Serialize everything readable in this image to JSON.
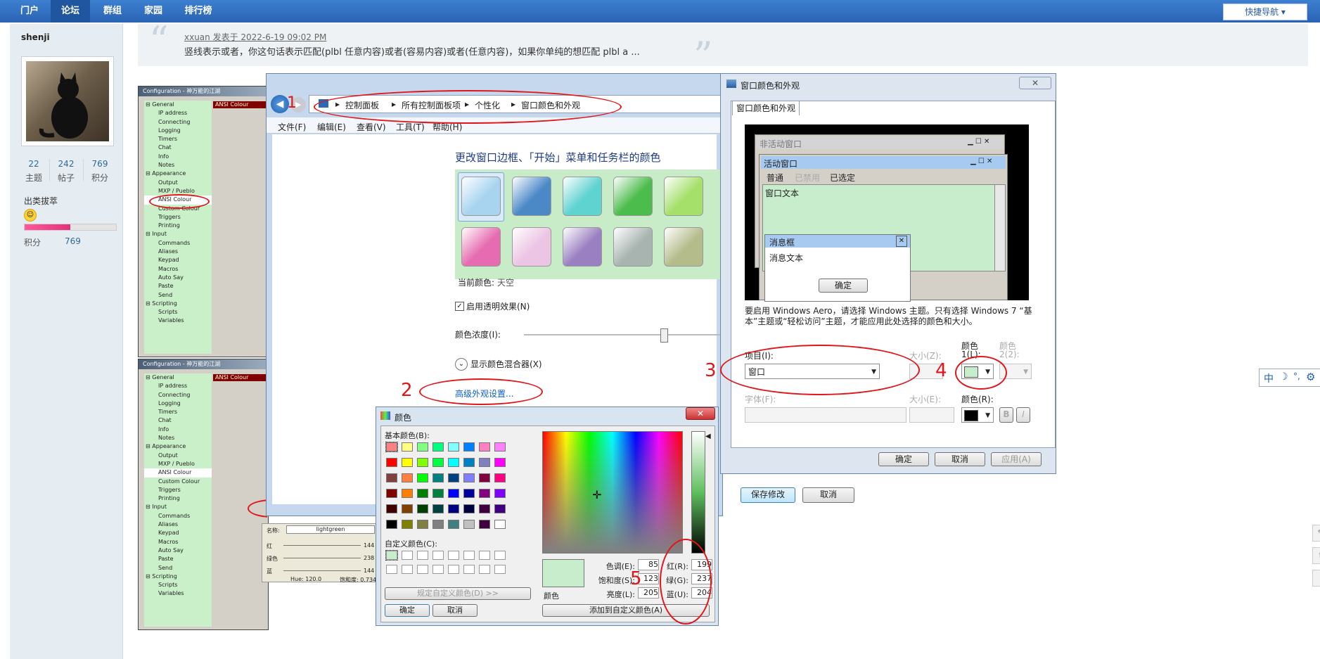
{
  "nav": {
    "items": [
      "门户",
      "论坛",
      "群组",
      "家园",
      "排行榜"
    ],
    "quick_nav": "快捷导航 ▾"
  },
  "profile": {
    "username": "shenji",
    "stats": [
      {
        "value": "22",
        "label": "主题"
      },
      {
        "value": "242",
        "label": "帖子"
      },
      {
        "value": "769",
        "label": "积分"
      }
    ],
    "rank": "出类拔萃",
    "points_label": "积分",
    "points_value": "769",
    "progress_fraction": 0.5
  },
  "quote": {
    "meta": "xxuan 发表于 2022-6-19 09:02 PM",
    "text": "竖线表示或者，你这句话表示匹配(plbl 任意内容)或者(容易内容)或者(任意内容)，如果你单纯的想匹配 plbl a ..."
  },
  "config_panel": {
    "title": "Configuration - 神万能的江湖",
    "ansi_label": "ANSI Colour",
    "tree": [
      "General",
      "IP address",
      "Connecting",
      "Logging",
      "Timers",
      "Chat",
      "Info",
      "Notes",
      "Appearance",
      "Output",
      "MXP / Pueblo",
      "ANSI Colour",
      "Custom Colour",
      "Triggers",
      "Printing",
      "Input",
      "Commands",
      "Aliases",
      "Keypad",
      "Macros",
      "Auto Say",
      "Paste",
      "Send",
      "Scripting",
      "Scripts",
      "Variables"
    ]
  },
  "config_lower": {
    "name_label": "名称:",
    "name_value": "lightgreen",
    "sliders": [
      {
        "label": "红",
        "value": "144"
      },
      {
        "label": "绿色",
        "value": "238"
      },
      {
        "label": "蓝",
        "value": "144"
      }
    ],
    "footer_left": "Hue: 120.0",
    "footer_right": "饱和度: 0.734"
  },
  "control_panel": {
    "breadcrumbs": [
      "控制面板",
      "所有控制面板项",
      "个性化",
      "窗口颜色和外观"
    ],
    "menu": [
      "文件(F)",
      "编辑(E)",
      "查看(V)",
      "工具(T)",
      "帮助(H)"
    ],
    "heading": "更改窗口边框、「开始」菜单和任务栏的颜色",
    "swatches_row1": [
      "#a8d4f0",
      "#4a88c6",
      "#5fd3d0",
      "#4cbc4c",
      "#a4e06a"
    ],
    "swatches_row2": [
      "#e66bb0",
      "#ecc4e4",
      "#9a80c0",
      "#a8b4b0",
      "#b4bc8c"
    ],
    "current_color_label": "当前颜色:",
    "current_color_value": "天空",
    "transparency_label": "启用透明效果(N)",
    "intensity_label": "颜色浓度(I):",
    "intensity_fraction": 0.72,
    "mixer_label": "显示颜色混合器(X)",
    "advanced_link": "高级外观设置...",
    "save_button": "保存修改",
    "cancel_button": "取消"
  },
  "window_color": {
    "title": "窗口颜色和外观",
    "tab": "窗口颜色和外观",
    "inactive_window": "非活动窗口",
    "active_window": "活动窗口",
    "menu_items": [
      "普通",
      "已禁用",
      "已选定"
    ],
    "window_text": "窗口文本",
    "msgbox_title": "消息框",
    "msgbox_text": "消息文本",
    "msgbox_ok": "确定",
    "description": "要启用 Windows Aero，请选择 Windows 主题。只有选择 Windows 7 “基本”主题或“轻松访问”主题，才能应用此处选择的颜色和大小。",
    "item_label": "项目(I):",
    "item_value": "窗口",
    "size_label": "大小(Z):",
    "color1_label_top": "颜色",
    "color1_label_bottom": "1(L):",
    "color2_label_top": "颜色",
    "color2_label_bottom": "2(2):",
    "font_label": "字体(F):",
    "font_size_label": "大小(E):",
    "font_color_label": "颜色(R):",
    "bold_label": "B",
    "italic_label": "I",
    "ok_button": "确定",
    "cancel_button": "取消",
    "apply_button": "应用(A)",
    "color1_value": "#c7edcc",
    "font_color_value": "#000000"
  },
  "color_picker": {
    "title": "颜色",
    "basic_colors_label": "基本颜色(B):",
    "basic_colors": [
      "#ff8080",
      "#ffff80",
      "#80ff80",
      "#00ff80",
      "#80ffff",
      "#0080ff",
      "#ff80c0",
      "#ff80ff",
      "#ff0000",
      "#ffff00",
      "#80ff00",
      "#00ff40",
      "#00ffff",
      "#0080c0",
      "#8080c0",
      "#ff00ff",
      "#804040",
      "#ff8040",
      "#00ff00",
      "#008080",
      "#004080",
      "#8080ff",
      "#800040",
      "#ff0080",
      "#800000",
      "#ff8000",
      "#008000",
      "#008040",
      "#0000ff",
      "#0000a0",
      "#800080",
      "#8000ff",
      "#400000",
      "#804000",
      "#004000",
      "#004040",
      "#000080",
      "#000040",
      "#400040",
      "#400080",
      "#000000",
      "#808000",
      "#808040",
      "#808080",
      "#408080",
      "#c0c0c0",
      "#400040",
      "#ffffff"
    ],
    "custom_colors_label": "自定义颜色(C):",
    "define_custom_button": "规定自定义颜色(D) >>",
    "ok_button": "确定",
    "cancel_button": "取消",
    "color_solid_label": "颜色",
    "hue_label": "色调(E):",
    "hue_value": "85",
    "sat_label": "饱和度(S):",
    "sat_value": "123",
    "lum_label": "亮度(L):",
    "lum_value": "205",
    "red_label": "红(R):",
    "red_value": "199",
    "green_label": "绿(G):",
    "green_value": "237",
    "blue_label": "蓝(U):",
    "blue_value": "204",
    "add_custom_button": "添加到自定义颜色(A)",
    "selected_color": "#c7edcc"
  },
  "annotations": [
    "1",
    "2",
    "3",
    "4",
    "5"
  ],
  "right_toolbar": {
    "items": [
      "中",
      "☽",
      "°,",
      "⚙"
    ]
  }
}
